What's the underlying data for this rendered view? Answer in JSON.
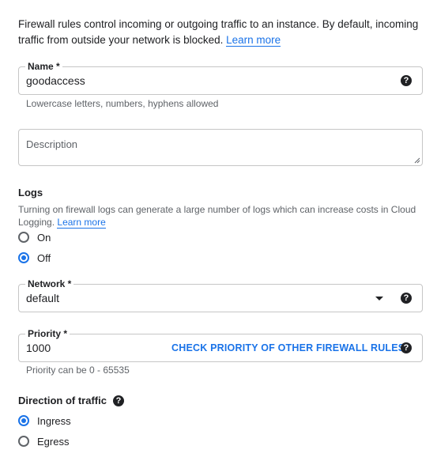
{
  "intro": {
    "text": "Firewall rules control incoming or outgoing traffic to an instance. By default, incoming traffic from outside your network is blocked.",
    "learn_more": "Learn more"
  },
  "name_field": {
    "label": "Name *",
    "value": "goodaccess",
    "help": "?",
    "hint": "Lowercase letters, numbers, hyphens allowed"
  },
  "description_field": {
    "placeholder": "Description"
  },
  "logs": {
    "title": "Logs",
    "description": "Turning on firewall logs can generate a large number of logs which can increase costs in Cloud Logging.",
    "learn_more": "Learn more",
    "options": [
      {
        "label": "On",
        "selected": false
      },
      {
        "label": "Off",
        "selected": true
      }
    ]
  },
  "network_field": {
    "label": "Network *",
    "value": "default",
    "help": "?"
  },
  "priority_field": {
    "label": "Priority *",
    "value": "1000",
    "check_link": "CHECK PRIORITY OF OTHER FIREWALL RULES",
    "help": "?",
    "hint": "Priority can be 0 - 65535"
  },
  "direction": {
    "title": "Direction of traffic",
    "help": "?",
    "options": [
      {
        "label": "Ingress",
        "selected": true
      },
      {
        "label": "Egress",
        "selected": false
      }
    ]
  },
  "colors": {
    "accent": "#1a73e8",
    "text": "#202124",
    "hint": "#5f6368",
    "border": "#c6c6c6"
  }
}
